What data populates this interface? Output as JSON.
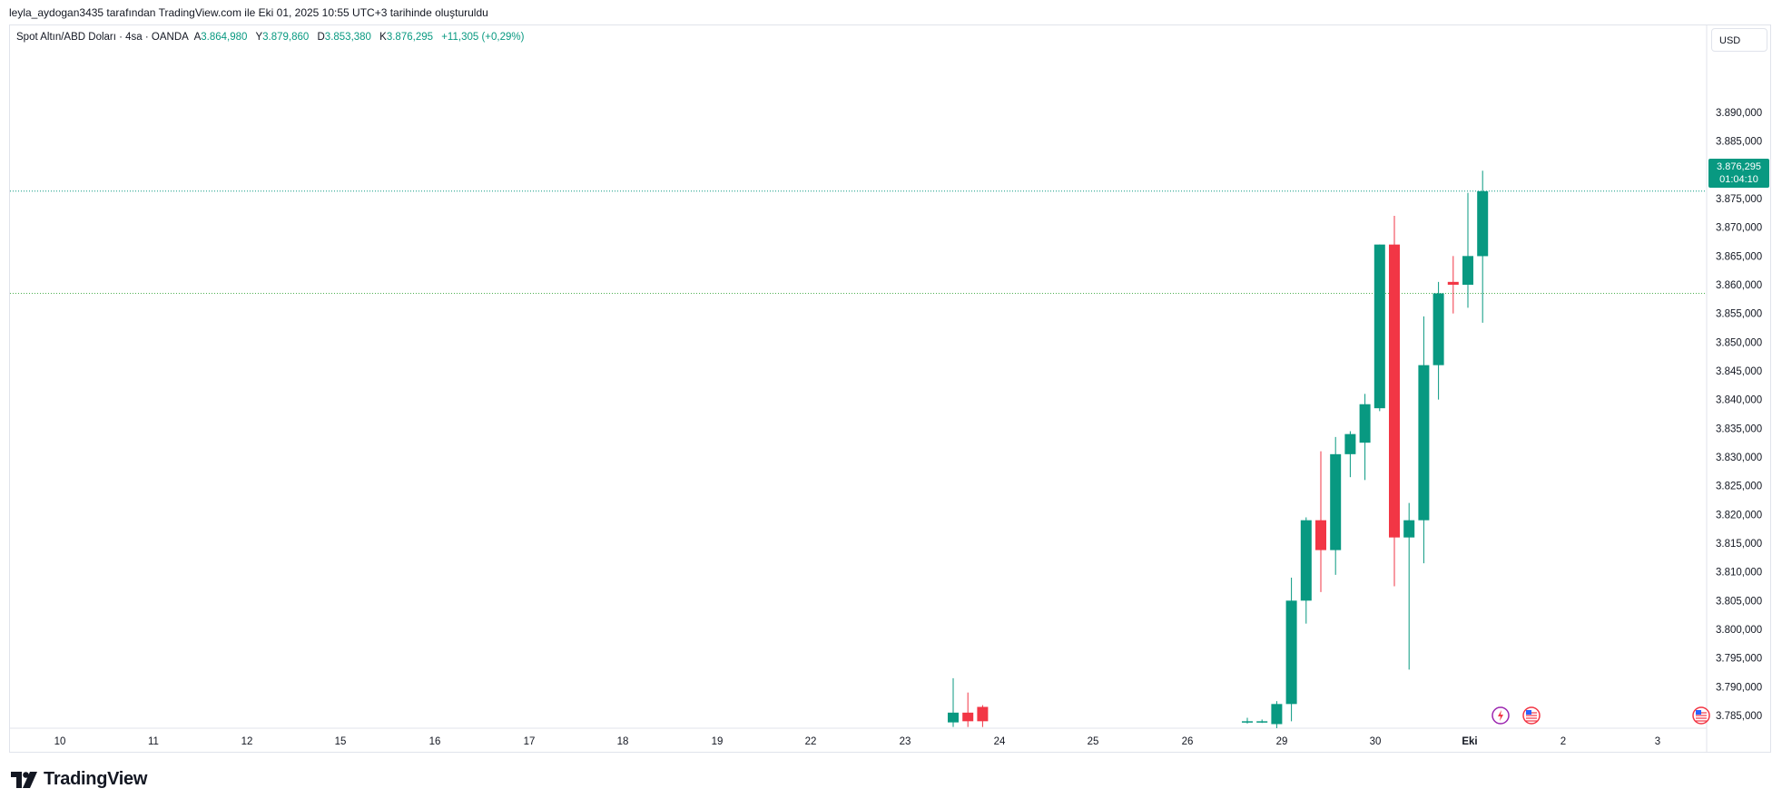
{
  "header": {
    "text": "leyla_aydogan3435 tarafından TradingView.com ile Eki 01, 2025 10:55 UTC+3 tarihinde oluşturuldu"
  },
  "legend": {
    "symbol": "Spot Altın/ABD Doları · 4sa · OANDA",
    "open_label": "A",
    "open": "3.864,980",
    "high_label": "Y",
    "high": "3.879,860",
    "low_label": "D",
    "low": "3.853,380",
    "close_label": "K",
    "close": "3.876,295",
    "change": "+11,305 (+0,29%)"
  },
  "currency": "USD",
  "price_tag": {
    "price": "3.876,295",
    "countdown": "01:04:10"
  },
  "brand": "TradingView",
  "colors": {
    "up": "#089981",
    "down": "#f23645",
    "grid_text": "#131722",
    "current_line": "#089981"
  },
  "chart_data": {
    "type": "candlestick",
    "y_axis_ticks": [
      "3.785,000",
      "3.790,000",
      "3.795,000",
      "3.800,000",
      "3.805,000",
      "3.810,000",
      "3.815,000",
      "3.820,000",
      "3.825,000",
      "3.830,000",
      "3.835,000",
      "3.840,000",
      "3.845,000",
      "3.850,000",
      "3.855,000",
      "3.860,000",
      "3.865,000",
      "3.870,000",
      "3.875,000",
      "3.880,000",
      "3.885,000",
      "3.890,000"
    ],
    "y_tick_values": [
      3785,
      3790,
      3795,
      3800,
      3805,
      3810,
      3815,
      3820,
      3825,
      3830,
      3835,
      3840,
      3845,
      3850,
      3855,
      3860,
      3865,
      3870,
      3875,
      3880,
      3885,
      3890
    ],
    "x_axis_labels": [
      "10",
      "11",
      "12",
      "15",
      "16",
      "17",
      "18",
      "19",
      "22",
      "23",
      "24",
      "25",
      "26",
      "29",
      "30",
      "Eki",
      "2",
      "3"
    ],
    "current_price": 3876.295,
    "reference_line": 3858.5,
    "candles": [
      {
        "slot": 0,
        "o": 3783.8,
        "h": 3791.5,
        "l": 3783.0,
        "c": 3785.5
      },
      {
        "slot": 1,
        "o": 3785.5,
        "h": 3789.0,
        "l": 3783.0,
        "c": 3784.0
      },
      {
        "slot": 2,
        "o": 3786.5,
        "h": 3786.8,
        "l": 3783.0,
        "c": 3784.0
      },
      {
        "slot": 20,
        "o": 3783.8,
        "h": 3784.6,
        "l": 3783.6,
        "c": 3784.0
      },
      {
        "slot": 21,
        "o": 3783.8,
        "h": 3784.3,
        "l": 3783.7,
        "c": 3784.0
      },
      {
        "slot": 22,
        "o": 3783.5,
        "h": 3787.5,
        "l": 3782.5,
        "c": 3787.0
      },
      {
        "slot": 23,
        "o": 3787.0,
        "h": 3809.0,
        "l": 3784.0,
        "c": 3805.0
      },
      {
        "slot": 24,
        "o": 3805.0,
        "h": 3819.5,
        "l": 3801.0,
        "c": 3819.0
      },
      {
        "slot": 25,
        "o": 3819.0,
        "h": 3831.0,
        "l": 3806.5,
        "c": 3813.8
      },
      {
        "slot": 26,
        "o": 3813.8,
        "h": 3833.5,
        "l": 3809.5,
        "c": 3830.5
      },
      {
        "slot": 27,
        "o": 3830.5,
        "h": 3834.5,
        "l": 3826.5,
        "c": 3834.0
      },
      {
        "slot": 28,
        "o": 3832.5,
        "h": 3841.0,
        "l": 3826.0,
        "c": 3839.2
      },
      {
        "slot": 29,
        "o": 3838.5,
        "h": 3867.0,
        "l": 3838.0,
        "c": 3867.0
      },
      {
        "slot": 30,
        "o": 3867.0,
        "h": 3872.0,
        "l": 3807.5,
        "c": 3816.0
      },
      {
        "slot": 31,
        "o": 3816.0,
        "h": 3822.0,
        "l": 3793.0,
        "c": 3819.0
      },
      {
        "slot": 32,
        "o": 3819.0,
        "h": 3854.5,
        "l": 3811.5,
        "c": 3846.0
      },
      {
        "slot": 33,
        "o": 3846.0,
        "h": 3860.5,
        "l": 3840.0,
        "c": 3858.5
      },
      {
        "slot": 34,
        "o": 3860.5,
        "h": 3865.0,
        "l": 3855.0,
        "c": 3860.0
      },
      {
        "slot": 35,
        "o": 3860.0,
        "h": 3876.0,
        "l": 3856.0,
        "c": 3865.0
      },
      {
        "slot": 36,
        "o": 3864.98,
        "h": 3879.86,
        "l": 3853.38,
        "c": 3876.295
      }
    ],
    "event_markers": [
      "lightning-event-icon",
      "us-flag-event-icon",
      "us-flag-event-icon"
    ]
  }
}
